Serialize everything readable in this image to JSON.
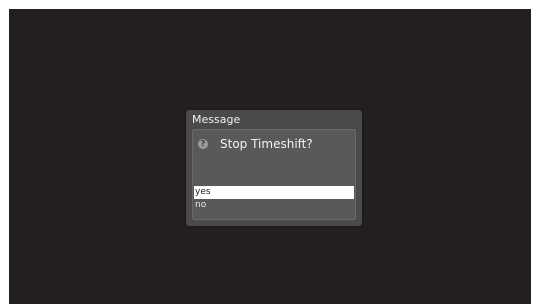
{
  "dialog": {
    "title": "Message",
    "icon": "question-icon",
    "icon_glyph": "?",
    "question": "Stop Timeshift?",
    "options": [
      {
        "label": "yes",
        "selected": true
      },
      {
        "label": "no",
        "selected": false
      }
    ]
  },
  "colors": {
    "screen_background": "#231f20",
    "dialog_background": "#4a4a4a",
    "selected_option_background": "#ffffff"
  }
}
